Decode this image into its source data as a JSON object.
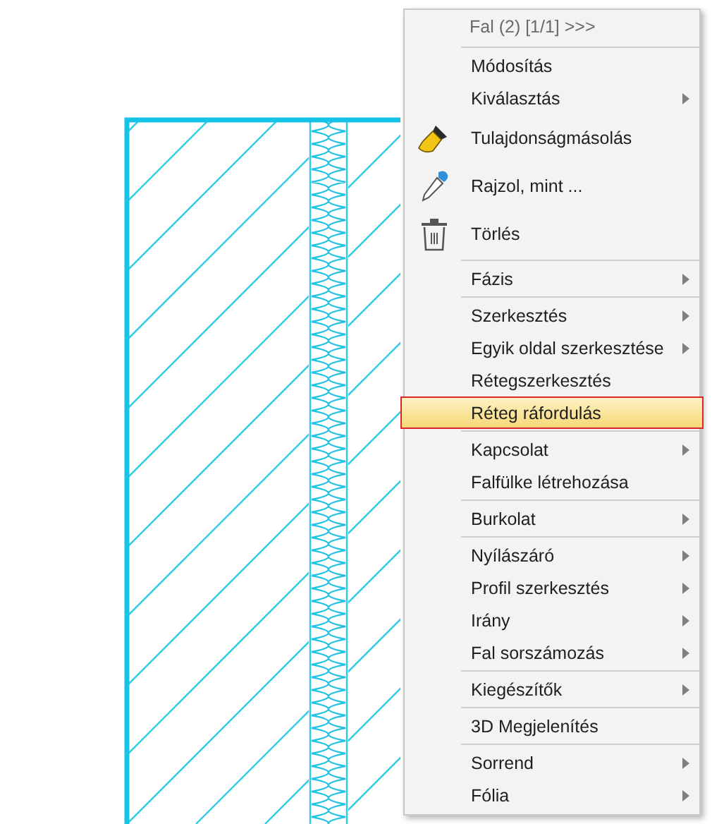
{
  "menu": {
    "header": "Fal (2) [1/1] >>>",
    "groups": [
      {
        "items": [
          {
            "label": "Módosítás",
            "kind": "text",
            "submenu": false,
            "selected": false
          },
          {
            "label": "Kiválasztás",
            "kind": "text",
            "submenu": true,
            "selected": false
          },
          {
            "label": "Tulajdonságmásolás",
            "kind": "brush",
            "submenu": false,
            "selected": false
          },
          {
            "label": "Rajzol, mint ...",
            "kind": "dropper",
            "submenu": false,
            "selected": false
          },
          {
            "label": "Törlés",
            "kind": "trash",
            "submenu": false,
            "selected": false
          }
        ]
      },
      {
        "items": [
          {
            "label": "Fázis",
            "kind": "text",
            "submenu": true,
            "selected": false
          }
        ]
      },
      {
        "items": [
          {
            "label": "Szerkesztés",
            "kind": "text",
            "submenu": true,
            "selected": false
          },
          {
            "label": "Egyik oldal szerkesztése",
            "kind": "text",
            "submenu": true,
            "selected": false
          },
          {
            "label": "Rétegszerkesztés",
            "kind": "text",
            "submenu": false,
            "selected": false
          },
          {
            "label": "Réteg ráfordulás",
            "kind": "text",
            "submenu": false,
            "selected": true
          }
        ]
      },
      {
        "items": [
          {
            "label": "Kapcsolat",
            "kind": "text",
            "submenu": true,
            "selected": false
          },
          {
            "label": "Falfülke létrehozása",
            "kind": "text",
            "submenu": false,
            "selected": false
          }
        ]
      },
      {
        "items": [
          {
            "label": "Burkolat",
            "kind": "text",
            "submenu": true,
            "selected": false
          }
        ]
      },
      {
        "items": [
          {
            "label": "Nyílászáró",
            "kind": "text",
            "submenu": true,
            "selected": false
          },
          {
            "label": "Profil szerkesztés",
            "kind": "text",
            "submenu": true,
            "selected": false
          },
          {
            "label": "Irány",
            "kind": "text",
            "submenu": true,
            "selected": false
          },
          {
            "label": "Fal sorszámozás",
            "kind": "text",
            "submenu": true,
            "selected": false
          }
        ]
      },
      {
        "items": [
          {
            "label": "Kiegészítők",
            "kind": "text",
            "submenu": true,
            "selected": false
          }
        ]
      },
      {
        "items": [
          {
            "label": "3D Megjelenítés",
            "kind": "text",
            "submenu": false,
            "selected": false
          }
        ]
      },
      {
        "items": [
          {
            "label": "Sorrend",
            "kind": "text",
            "submenu": true,
            "selected": false
          },
          {
            "label": "Fólia",
            "kind": "text",
            "submenu": true,
            "selected": false
          }
        ]
      }
    ]
  }
}
